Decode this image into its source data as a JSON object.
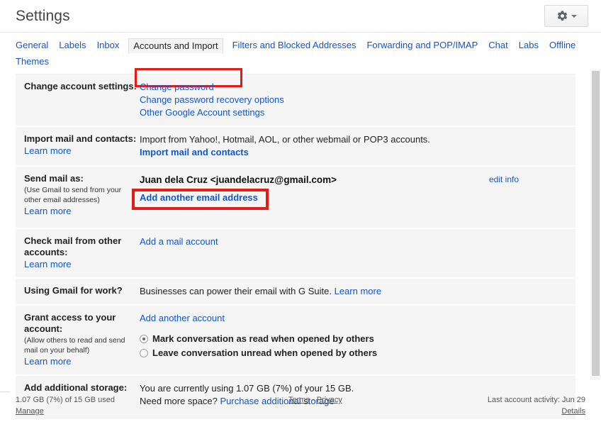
{
  "header": {
    "title": "Settings",
    "gear_icon": "gear-icon",
    "caret_icon": "chevron-down-icon"
  },
  "tabs": [
    {
      "label": "General",
      "active": false
    },
    {
      "label": "Labels",
      "active": false
    },
    {
      "label": "Inbox",
      "active": false
    },
    {
      "label": "Accounts and Import",
      "active": true
    },
    {
      "label": "Filters and Blocked Addresses",
      "active": false
    },
    {
      "label": "Forwarding and POP/IMAP",
      "active": false
    },
    {
      "label": "Chat",
      "active": false
    },
    {
      "label": "Labs",
      "active": false
    },
    {
      "label": "Offline",
      "active": false
    },
    {
      "label": "Themes",
      "active": false
    }
  ],
  "annotations": {
    "color": "#e41b17",
    "tab_highlight": "Accounts and Import",
    "link_highlight": "Add another email address"
  },
  "rows": {
    "change_account": {
      "title": "Change account settings:",
      "links": [
        "Change password",
        "Change password recovery options",
        "Other Google Account settings"
      ]
    },
    "import_mail": {
      "title": "Import mail and contacts:",
      "learn_more": "Learn more",
      "description": "Import from Yahoo!, Hotmail, AOL, or other webmail or POP3 accounts.",
      "action": "Import mail and contacts"
    },
    "send_mail_as": {
      "title": "Send mail as:",
      "sub": "(Use Gmail to send from your other email addresses)",
      "learn_more": "Learn more",
      "address": "Juan dela Cruz <juandelacruz@gmail.com>",
      "edit_info": "edit info",
      "action": "Add another email address"
    },
    "check_mail": {
      "title": "Check mail from other accounts:",
      "learn_more": "Learn more",
      "action": "Add a mail account"
    },
    "gmail_for_work": {
      "title": "Using Gmail for work?",
      "description": "Businesses can power their email with G Suite.",
      "learn_more": "Learn more"
    },
    "grant_access": {
      "title": "Grant access to your account:",
      "sub": "(Allow others to read and send mail on your behalf)",
      "learn_more": "Learn more",
      "action": "Add another account",
      "options": [
        {
          "label": "Mark conversation as read when opened by others",
          "selected": true
        },
        {
          "label": "Leave conversation unread when opened by others",
          "selected": false
        }
      ]
    },
    "storage": {
      "title": "Add additional storage:",
      "usage": "You are currently using 1.07 GB (7%) of your 15 GB.",
      "need_space": "Need more space?",
      "purchase_link": "Purchase additional storage"
    }
  },
  "footer": {
    "storage_used": "1.07 GB (7%) of 15 GB used",
    "manage": "Manage",
    "terms": "Terms",
    "separator": "-",
    "privacy": "Privacy",
    "last_activity": "Last account activity: Jun 29",
    "details": "Details"
  }
}
